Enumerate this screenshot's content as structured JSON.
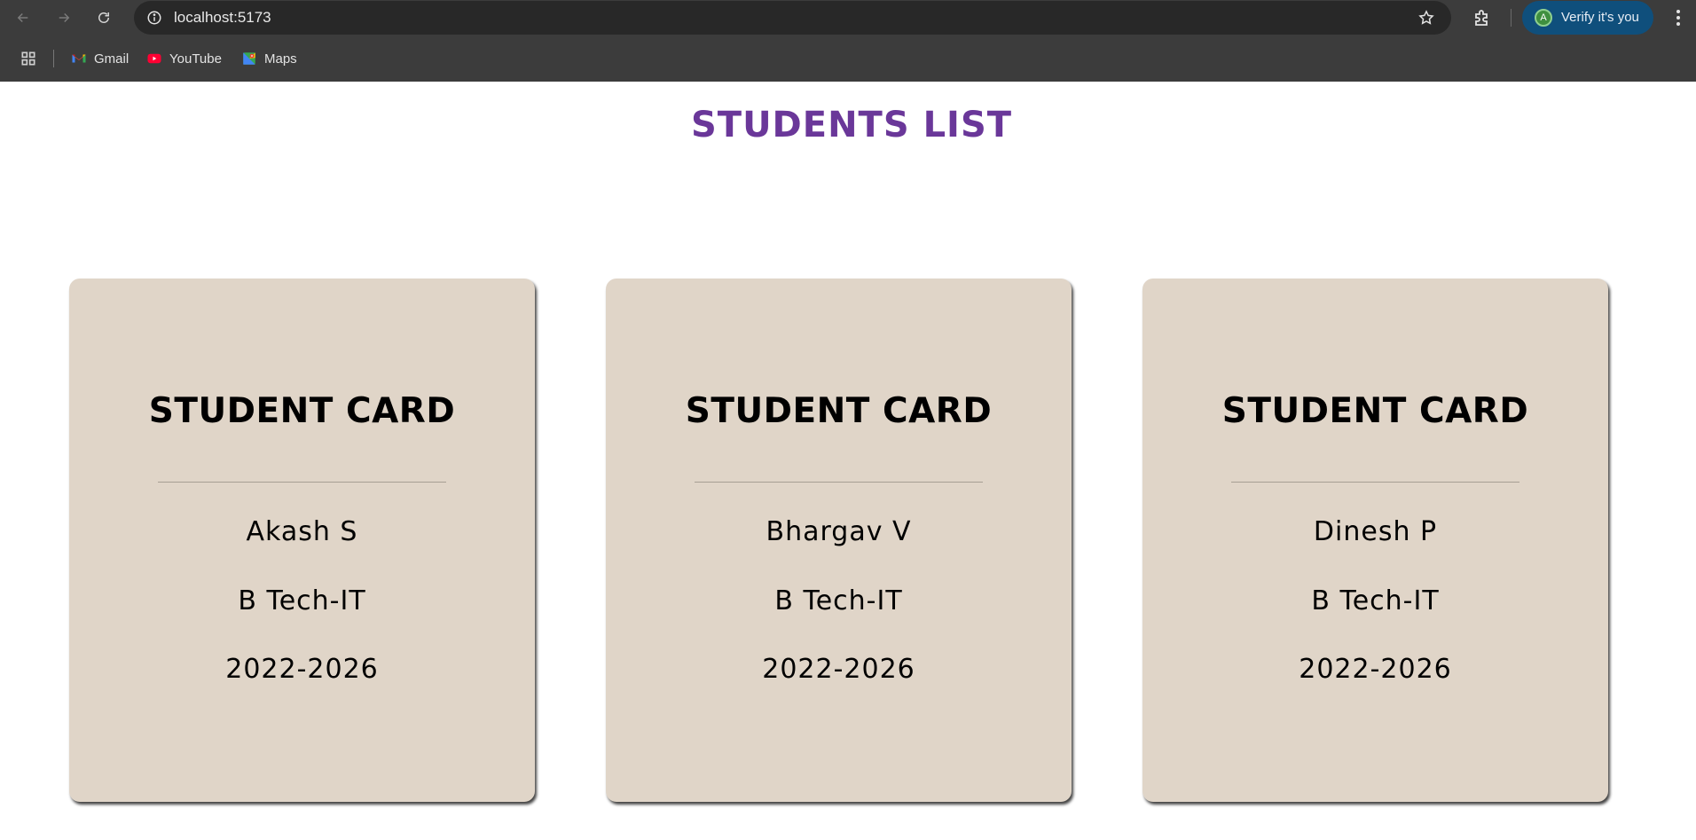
{
  "browser": {
    "url": "localhost:5173",
    "verify_label": "Verify it's you",
    "avatar_initial": "A",
    "bookmarks": [
      {
        "label": "Gmail",
        "icon": "gmail-icon"
      },
      {
        "label": "YouTube",
        "icon": "youtube-icon"
      },
      {
        "label": "Maps",
        "icon": "maps-icon"
      }
    ]
  },
  "page": {
    "title": "STUDENTS LIST",
    "title_color": "#6a3799",
    "card_color": "#e0d5c8"
  },
  "cards": [
    {
      "heading": "STUDENT CARD",
      "name": "Akash S",
      "course": "B Tech-IT",
      "batch": "2022-2026"
    },
    {
      "heading": "STUDENT CARD",
      "name": "Bhargav V",
      "course": "B Tech-IT",
      "batch": "2022-2026"
    },
    {
      "heading": "STUDENT CARD",
      "name": "Dinesh P",
      "course": "B Tech-IT",
      "batch": "2022-2026"
    }
  ]
}
